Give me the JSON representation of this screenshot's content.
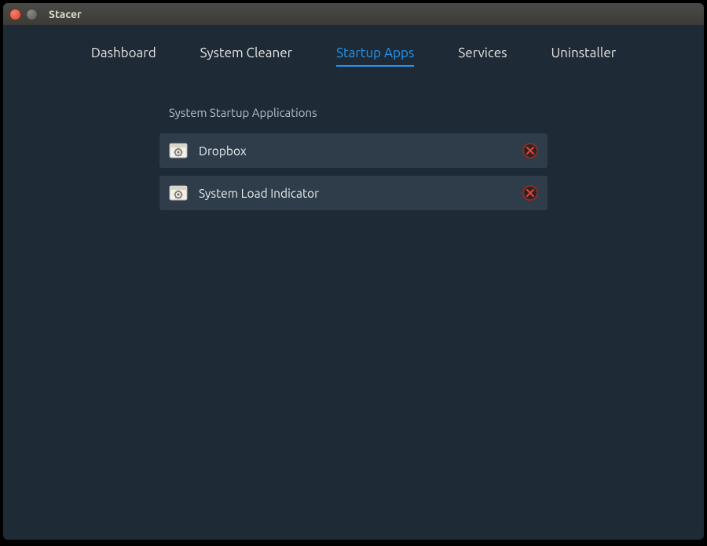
{
  "window": {
    "title": "Stacer"
  },
  "tabs": {
    "dashboard": "Dashboard",
    "system_cleaner": "System Cleaner",
    "startup_apps": "Startup Apps",
    "services": "Services",
    "uninstaller": "Uninstaller",
    "active": "startup_apps"
  },
  "section": {
    "title": "System Startup Applications"
  },
  "apps": [
    {
      "name": "Dropbox"
    },
    {
      "name": "System Load Indicator"
    }
  ],
  "colors": {
    "accent": "#2196f3",
    "bg": "#1e2a35",
    "row": "#2f3d4a"
  }
}
